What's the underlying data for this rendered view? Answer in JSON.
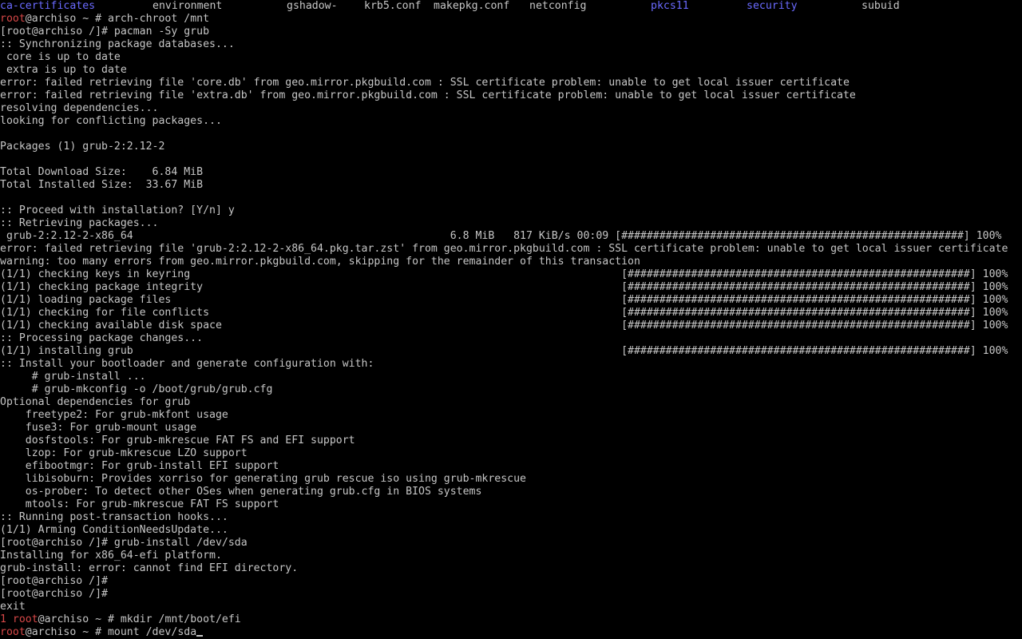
{
  "colors": {
    "background": "#000000",
    "text": "#c6c6c6",
    "prompt_red": "#d84848",
    "dir_blue": "#6a6aff"
  },
  "ls_row": [
    {
      "text": "ca-certificates",
      "color": "blue"
    },
    {
      "text": "environment",
      "color": "gray"
    },
    {
      "text": "gshadow-",
      "color": "gray"
    },
    {
      "text": "krb5.conf",
      "color": "gray"
    },
    {
      "text": "makepkg.conf",
      "color": "gray"
    },
    {
      "text": "netconfig",
      "color": "gray"
    },
    {
      "text": "pkcs11",
      "color": "blue"
    },
    {
      "text": "security",
      "color": "blue"
    },
    {
      "text": "subuid",
      "color": "gray"
    }
  ],
  "lines": [
    [
      {
        "t": "root",
        "c": "red"
      },
      {
        "t": "@archiso ~ # arch-chroot /mnt"
      }
    ],
    [
      {
        "t": "[root@archiso /]# pacman -Sy grub"
      }
    ],
    [
      {
        "t": ":: Synchronizing package databases..."
      }
    ],
    [
      {
        "t": " core is up to date"
      }
    ],
    [
      {
        "t": " extra is up to date"
      }
    ],
    [
      {
        "t": "error: failed retrieving file 'core.db' from geo.mirror.pkgbuild.com : SSL certificate problem: unable to get local issuer certificate"
      }
    ],
    [
      {
        "t": "error: failed retrieving file 'extra.db' from geo.mirror.pkgbuild.com : SSL certificate problem: unable to get local issuer certificate"
      }
    ],
    [
      {
        "t": "resolving dependencies..."
      }
    ],
    [
      {
        "t": "looking for conflicting packages..."
      }
    ],
    [
      {
        "t": ""
      }
    ],
    [
      {
        "t": "Packages (1) grub-2:2.12-2"
      }
    ],
    [
      {
        "t": ""
      }
    ],
    [
      {
        "t": "Total Download Size:    6.84 MiB"
      }
    ],
    [
      {
        "t": "Total Installed Size:  33.67 MiB"
      }
    ],
    [
      {
        "t": ""
      }
    ],
    [
      {
        "t": ":: Proceed with installation? [Y/n] y"
      }
    ],
    [
      {
        "t": ":: Retrieving packages..."
      }
    ],
    [
      {
        "t": " grub-2:2.12-2-x86_64                                                  6.8 MiB   817 KiB/s 00:09 [######################################################] 100%"
      }
    ],
    [
      {
        "t": "error: failed retrieving file 'grub-2:2.12-2-x86_64.pkg.tar.zst' from geo.mirror.pkgbuild.com : SSL certificate problem: unable to get local issuer certificate"
      }
    ],
    [
      {
        "t": "warning: too many errors from geo.mirror.pkgbuild.com, skipping for the remainder of this transaction"
      }
    ],
    [
      {
        "t": "(1/1) checking keys in keyring                                                                    [######################################################] 100%"
      }
    ],
    [
      {
        "t": "(1/1) checking package integrity                                                                  [######################################################] 100%"
      }
    ],
    [
      {
        "t": "(1/1) loading package files                                                                       [######################################################] 100%"
      }
    ],
    [
      {
        "t": "(1/1) checking for file conflicts                                                                 [######################################################] 100%"
      }
    ],
    [
      {
        "t": "(1/1) checking available disk space                                                               [######################################################] 100%"
      }
    ],
    [
      {
        "t": ":: Processing package changes..."
      }
    ],
    [
      {
        "t": "(1/1) installing grub                                                                             [######################################################] 100%"
      }
    ],
    [
      {
        "t": ":: Install your bootloader and generate configuration with:"
      }
    ],
    [
      {
        "t": "     # grub-install ..."
      }
    ],
    [
      {
        "t": "     # grub-mkconfig -o /boot/grub/grub.cfg"
      }
    ],
    [
      {
        "t": "Optional dependencies for grub"
      }
    ],
    [
      {
        "t": "    freetype2: For grub-mkfont usage"
      }
    ],
    [
      {
        "t": "    fuse3: For grub-mount usage"
      }
    ],
    [
      {
        "t": "    dosfstools: For grub-mkrescue FAT FS and EFI support"
      }
    ],
    [
      {
        "t": "    lzop: For grub-mkrescue LZO support"
      }
    ],
    [
      {
        "t": "    efibootmgr: For grub-install EFI support"
      }
    ],
    [
      {
        "t": "    libisoburn: Provides xorriso for generating grub rescue iso using grub-mkrescue"
      }
    ],
    [
      {
        "t": "    os-prober: To detect other OSes when generating grub.cfg in BIOS systems"
      }
    ],
    [
      {
        "t": "    mtools: For grub-mkrescue FAT FS support"
      }
    ],
    [
      {
        "t": ":: Running post-transaction hooks..."
      }
    ],
    [
      {
        "t": "(1/1) Arming ConditionNeedsUpdate..."
      }
    ],
    [
      {
        "t": "[root@archiso /]# grub-install /dev/sda"
      }
    ],
    [
      {
        "t": "Installing for x86_64-efi platform."
      }
    ],
    [
      {
        "t": "grub-install: error: cannot find EFI directory."
      }
    ],
    [
      {
        "t": "[root@archiso /]#"
      }
    ],
    [
      {
        "t": "[root@archiso /]#"
      }
    ],
    [
      {
        "t": "exit"
      }
    ],
    [
      {
        "t": "1 ",
        "c": "red"
      },
      {
        "t": "root",
        "c": "red"
      },
      {
        "t": "@archiso ~ # mkdir /mnt/boot/efi"
      }
    ],
    [
      {
        "t": "root",
        "c": "red"
      },
      {
        "t": "@archiso ~ # mount /dev/sda"
      }
    ]
  ]
}
